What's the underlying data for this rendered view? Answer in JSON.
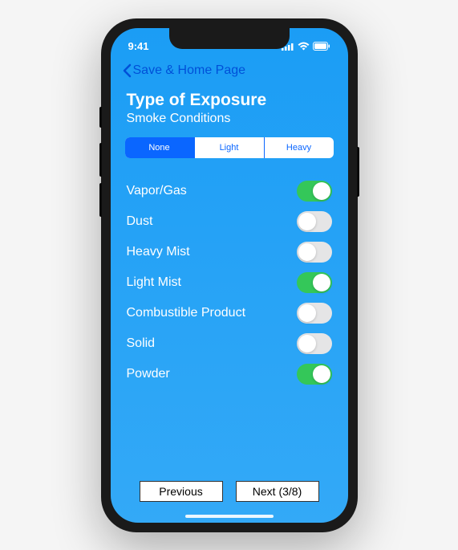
{
  "status": {
    "time": "9:41"
  },
  "nav": {
    "back_label": "Save & Home Page"
  },
  "header": {
    "title": "Type of Exposure",
    "subtitle": "Smoke Conditions"
  },
  "segments": {
    "items": [
      "None",
      "Light",
      "Heavy"
    ],
    "active_index": 0
  },
  "list": {
    "items": [
      {
        "label": "Vapor/Gas",
        "on": true
      },
      {
        "label": "Dust",
        "on": false
      },
      {
        "label": "Heavy Mist",
        "on": false
      },
      {
        "label": "Light Mist",
        "on": true
      },
      {
        "label": "Combustible Product",
        "on": false
      },
      {
        "label": "Solid",
        "on": false
      },
      {
        "label": "Powder",
        "on": true
      }
    ]
  },
  "footer": {
    "previous": "Previous",
    "next": "Next (3/8)"
  }
}
